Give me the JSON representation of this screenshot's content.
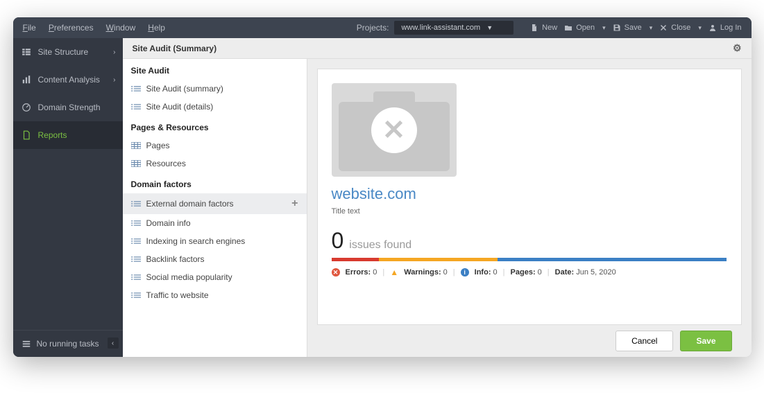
{
  "menubar": {
    "file": "File",
    "preferences": "Preferences",
    "window": "Window",
    "help": "Help",
    "projects_label": "Projects:",
    "project_selected": "www.link-assistant.com",
    "new": "New",
    "open": "Open",
    "save": "Save",
    "close": "Close",
    "login": "Log In"
  },
  "sidebar": {
    "site_structure": "Site Structure",
    "content_analysis": "Content Analysis",
    "domain_strength": "Domain Strength",
    "reports": "Reports",
    "no_tasks": "No running tasks"
  },
  "header": {
    "title": "Site Audit (Summary)"
  },
  "categories": {
    "group1": "Site Audit",
    "g1_item1": "Site Audit (summary)",
    "g1_item2": "Site Audit (details)",
    "group2": "Pages & Resources",
    "g2_item1": "Pages",
    "g2_item2": "Resources",
    "group3": "Domain factors",
    "g3_item1": "External domain factors",
    "g3_item2": "Domain info",
    "g3_item3": "Indexing in search engines",
    "g3_item4": "Backlink factors",
    "g3_item5": "Social media popularity",
    "g3_item6": "Traffic to website"
  },
  "preview": {
    "site": "website.com",
    "title_text": "Title text",
    "issues_count": "0",
    "issues_label": "issues found",
    "errors_label": "Errors:",
    "errors_val": "0",
    "warnings_label": "Warnings:",
    "warnings_val": "0",
    "info_label": "Info:",
    "info_val": "0",
    "pages_label": "Pages:",
    "pages_val": "0",
    "date_label": "Date:",
    "date_val": "Jun 5, 2020"
  },
  "footer": {
    "cancel": "Cancel",
    "save": "Save"
  }
}
